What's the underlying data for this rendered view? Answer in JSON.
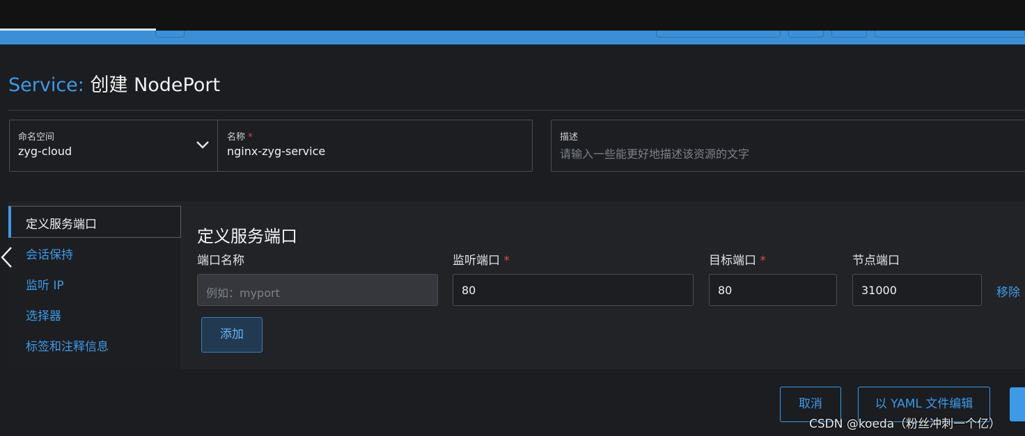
{
  "header": {
    "title_prefix": "Service:",
    "title_main": "创建 NodePort"
  },
  "form": {
    "namespace": {
      "label": "命名空间",
      "value": "zyg-cloud"
    },
    "name": {
      "label": "名称",
      "required_mark": "*",
      "value": "nginx-zyg-service"
    },
    "description": {
      "label": "描述",
      "placeholder": "请输入一些能更好地描述该资源的文字"
    }
  },
  "sidebar": {
    "items": [
      {
        "label": "定义服务端口"
      },
      {
        "label": "会话保持"
      },
      {
        "label": "监听 IP"
      },
      {
        "label": "选择器"
      },
      {
        "label": "标签和注释信息"
      }
    ]
  },
  "ports_section": {
    "title": "定义服务端口",
    "columns": {
      "port_name": "端口名称",
      "listen_port": "监听端口",
      "target_port": "目标端口",
      "node_port": "节点端口",
      "required_mark": "*"
    },
    "row": {
      "port_name_placeholder": "例如：myport",
      "listen_port": "80",
      "target_port": "80",
      "node_port": "31000",
      "remove_label": "移除"
    },
    "add_label": "添加"
  },
  "footer": {
    "cancel_label": "取消",
    "yaml_label": "以 YAML 文件编辑"
  },
  "watermark": "CSDN @koeda（粉丝冲刺一个亿）",
  "colors": {
    "accent": "#3d9ae6",
    "background": "#1b1d21",
    "required": "#e04848",
    "header_bar": "#3a8fd6"
  },
  "icons": {
    "namespace_dropdown": "chevron-down-icon",
    "back": "chevron-left-icon"
  }
}
